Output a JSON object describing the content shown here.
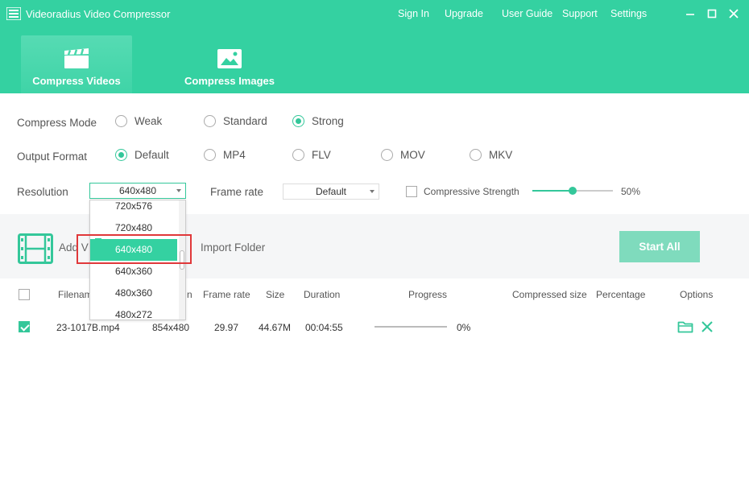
{
  "app": {
    "title": "Videoradius Video Compressor"
  },
  "top_links": [
    "Sign In",
    "Upgrade",
    "User Guide",
    "Support",
    "Settings"
  ],
  "tabs": [
    {
      "label": "Compress Videos",
      "active": true
    },
    {
      "label": "Compress Images",
      "active": false
    }
  ],
  "compress_mode": {
    "label": "Compress Mode",
    "options": [
      "Weak",
      "Standard",
      "Strong"
    ],
    "selected": "Strong"
  },
  "output_format": {
    "label": "Output Format",
    "options": [
      "Default",
      "MP4",
      "FLV",
      "MOV",
      "MKV"
    ],
    "selected": "Default"
  },
  "resolution": {
    "label": "Resolution",
    "value": "640x480",
    "options": [
      "720x576",
      "720x480",
      "640x480",
      "640x360",
      "480x360",
      "480x272"
    ],
    "selected": "640x480"
  },
  "frame_rate": {
    "label": "Frame rate",
    "value": "Default"
  },
  "compressive_strength": {
    "label": "Compressive Strength",
    "checked": false,
    "value": 50,
    "value_text": "50%"
  },
  "actions": {
    "add_video_visible": "Add V",
    "import_folder": "Import Folder",
    "start_all": "Start All"
  },
  "table": {
    "headers": {
      "filename_visible": "Filenam",
      "resolution_visible": "n",
      "frame_rate": "Frame rate",
      "size": "Size",
      "duration": "Duration",
      "progress": "Progress",
      "compressed_size": "Compressed size",
      "percentage": "Percentage",
      "options": "Options"
    },
    "rows": [
      {
        "checked": true,
        "filename": "23-1017B.mp4",
        "resolution": "854x480",
        "frame_rate": "29.97",
        "size": "44.67M",
        "duration": "00:04:55",
        "progress": 0,
        "progress_text": "0%"
      }
    ]
  },
  "colors": {
    "accent": "#34d1a1",
    "accent_dark": "#34c79a",
    "highlight": "#e0383a"
  },
  "icons": [
    "app-logo-icon",
    "minimize-icon",
    "maximize-icon",
    "close-icon",
    "clapperboard-icon",
    "image-icon",
    "film-strip-icon",
    "folder-icon",
    "delete-x-icon"
  ]
}
